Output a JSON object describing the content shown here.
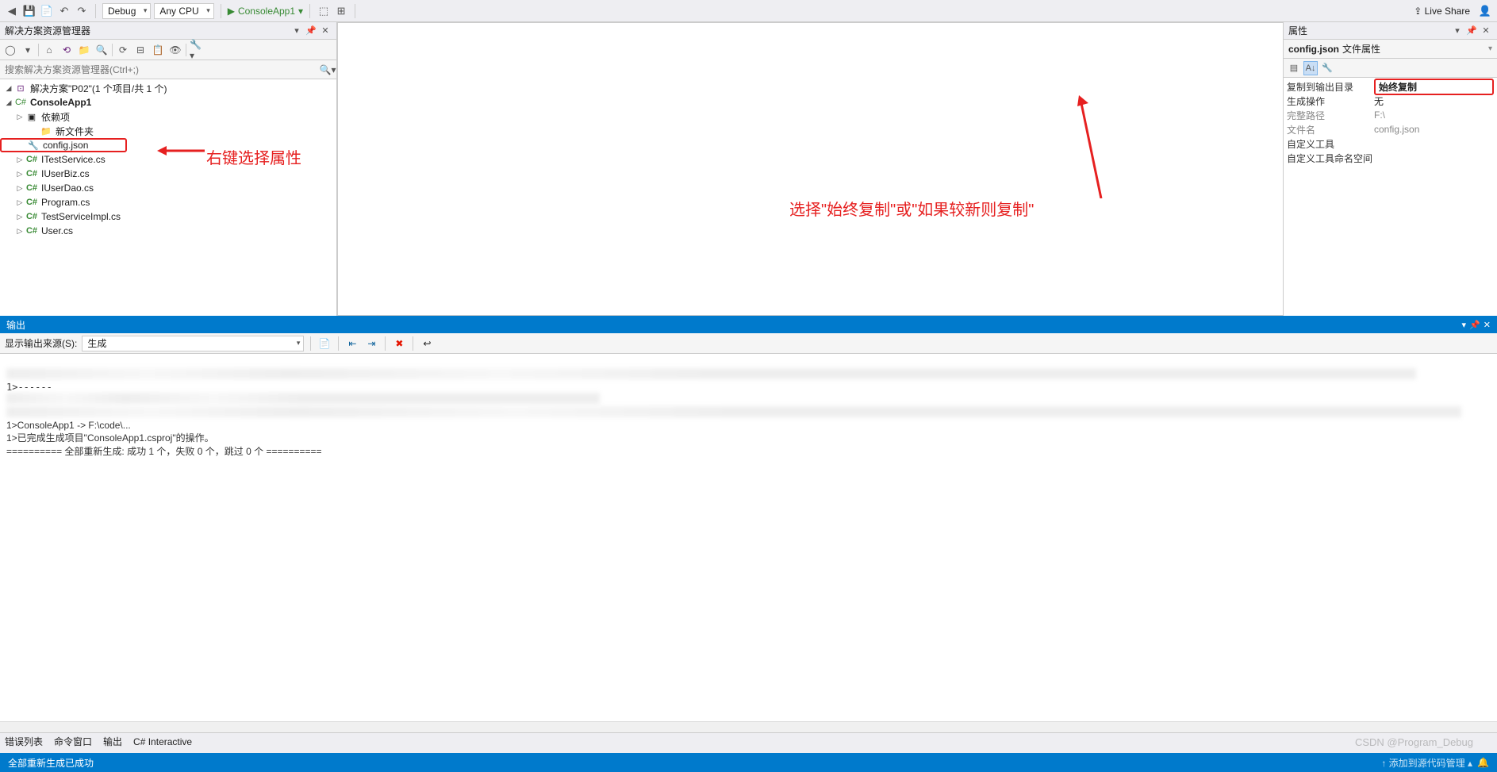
{
  "toolbar": {
    "config_label": "Debug",
    "platform_label": "Any CPU",
    "run_label": "ConsoleApp1",
    "liveshare": "Live Share"
  },
  "solution_explorer": {
    "title": "解决方案资源管理器",
    "search_placeholder": "搜索解决方案资源管理器(Ctrl+;)",
    "solution_label": "解决方案\"P02\"(1 个项目/共 1 个)",
    "project_label": "ConsoleApp1",
    "nodes": {
      "deps": "依赖项",
      "newfolder": "新文件夹",
      "config": "config.json",
      "itest": "ITestService.cs",
      "iuserbiz": "IUserBiz.cs",
      "iuserdao": "IUserDao.cs",
      "program": "Program.cs",
      "testimpl": "TestServiceImpl.cs",
      "user": "User.cs"
    }
  },
  "properties": {
    "title": "属性",
    "file_name": "config.json",
    "file_label": "文件属性",
    "rows": {
      "copy_to_out_k": "复制到输出目录",
      "copy_to_out_v": "始终复制",
      "build_action_k": "生成操作",
      "build_action_v": "无",
      "fullpath_k": "完整路径",
      "fullpath_v": "F:\\",
      "filename_k": "文件名",
      "filename_v": "config.json",
      "customtool_k": "自定义工具",
      "customtoolns_k": "自定义工具命名空间"
    }
  },
  "annotations": {
    "left_text": "右键选择属性",
    "right_text": "选择\"始终复制\"或\"如果较新则复制\""
  },
  "output": {
    "title": "输出",
    "source_label": "显示输出来源(S):",
    "source_value": "生成",
    "line1": "1>ConsoleApp1 -> F:\\code\\...",
    "line2": "1>已完成生成项目\"ConsoleApp1.csproj\"的操作。",
    "line3": "========== 全部重新生成: 成功 1 个，失败 0 个，跳过 0 个 =========="
  },
  "bottom_tabs": {
    "t1": "错误列表",
    "t2": "命令窗口",
    "t3": "输出",
    "t4": "C# Interactive"
  },
  "status": {
    "text": "全部重新生成已成功",
    "right": "↑ 添加到源代码管理 ▴"
  },
  "watermark": "CSDN @Program_Debug"
}
